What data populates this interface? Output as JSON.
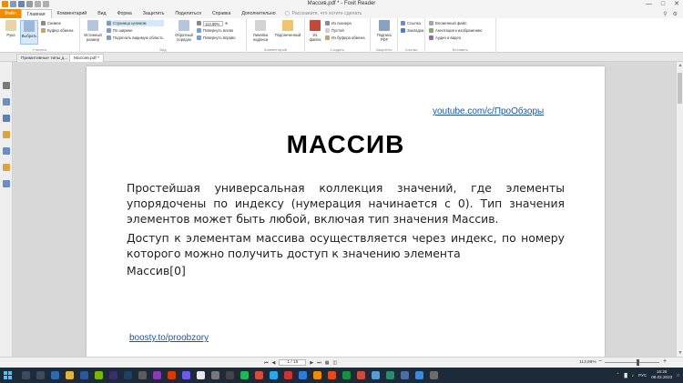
{
  "window": {
    "title": "Массив.pdf * - Foxit Reader",
    "controls": [
      "—",
      "□",
      "✕"
    ]
  },
  "ribbon_tabs": [
    "Файл",
    "Главная",
    "Комментарий",
    "Вид",
    "Форма",
    "Защитить",
    "Поделиться",
    "Справка",
    "Дополнительно"
  ],
  "tell_me_placeholder": "Расскажите, что хотите сделать",
  "ribbon": {
    "tools": {
      "hand": "Рука",
      "select": "Выбрать",
      "snapshot": "Снимок",
      "clipboard": "Буфер обмена",
      "label": "Утилиты"
    },
    "view": {
      "actual_size": "Истинный размер",
      "fit_page": "Страница целиком",
      "fit_width": "По ширине",
      "fit_visible": "Подогнать видимую область",
      "reverse_order": "Обратный порядок",
      "zoom": "113,89%",
      "rotate_left": "Повернуть влево",
      "rotate_right": "Повернуть вправо",
      "label": "Вид"
    },
    "comment": {
      "typewriter": "Линейка надписи",
      "highlight": "Подсвеченный",
      "label": "Комментарий"
    },
    "create": {
      "from_file": "Из файла",
      "from_scanner": "Из сканера",
      "blank": "Пустой",
      "from_clipboard": "Из буфера обмена",
      "label": "Создать"
    },
    "protect": {
      "sign": "Подпись PDF",
      "label": "Защитить"
    },
    "links": {
      "link": "Ссылка",
      "bookmark": "Закладка",
      "label": "Ссылки"
    },
    "insert": {
      "attachment": "Вложенный файл",
      "image_annotation": "Аннотация к изображению",
      "audio_video": "Аудио и видео",
      "label": "Вставить"
    }
  },
  "doc_tabs": [
    "Примитивные типы д...",
    "Массив.pdf *"
  ],
  "document": {
    "link_top": "youtube.com/c/ПроОбзоры",
    "heading": "МАССИВ",
    "paragraph1": "Простейшая универсальная коллекция значений, где элементы упорядочены по индексу (нумерация начинается с 0). Тип значения элементов может быть любой, включая тип значения Массив.",
    "paragraph2": "Доступ к элементам массива осуществляется через индекс, по номеру которого можно получить доступ к значению элемента",
    "paragraph3": "Массив[0]",
    "link_bottom": "boosty.to/proobzory"
  },
  "status": {
    "page": "1 / 15",
    "zoom": "113,89%",
    "zoom_level": 0.6
  },
  "taskbar": {
    "time": "16:26",
    "date": "08.02.2023",
    "lang": "РУС"
  },
  "colors": {
    "accent": "#f08c00",
    "link": "#1a56a8",
    "taskbar": "#1f2a38"
  }
}
